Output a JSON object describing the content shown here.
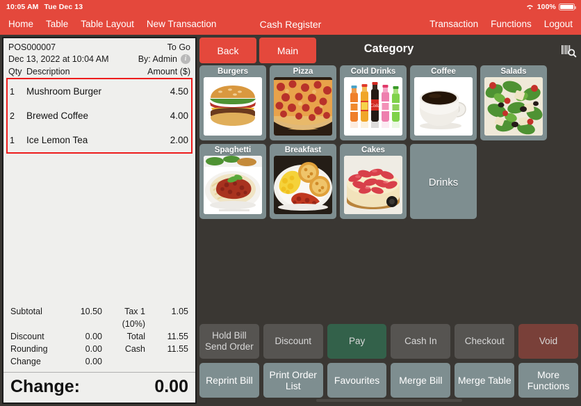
{
  "statusbar": {
    "time": "10:05 AM",
    "date": "Tue Dec 13",
    "wifi_icon": "wifi-icon",
    "battery_percent": "100%",
    "battery_icon": "battery-full-icon"
  },
  "navbar": {
    "title": "Cash Register",
    "left_items": [
      {
        "label": "Home",
        "name": "nav-home"
      },
      {
        "label": "Table",
        "name": "nav-table"
      },
      {
        "label": "Table Layout",
        "name": "nav-table-layout"
      },
      {
        "label": "New Transaction",
        "name": "nav-new-transaction"
      }
    ],
    "right_items": [
      {
        "label": "Transaction",
        "name": "nav-transaction"
      },
      {
        "label": "Functions",
        "name": "nav-functions"
      },
      {
        "label": "Logout",
        "name": "nav-logout"
      }
    ]
  },
  "receipt": {
    "order_id": "POS000007",
    "order_type": "To Go",
    "datetime": "Dec 13, 2022 at 10:04 AM",
    "cashier": "By: Admin",
    "info_icon": "info-icon",
    "columns": {
      "qty": "Qty",
      "description": "Description",
      "amount": "Amount ($)"
    },
    "items": [
      {
        "qty": "1",
        "description": "Mushroom Burger",
        "amount": "4.50"
      },
      {
        "qty": "2",
        "description": "Brewed Coffee",
        "amount": "4.00"
      },
      {
        "qty": "1",
        "description": "Ice Lemon Tea",
        "amount": "2.00"
      }
    ],
    "totals": [
      {
        "label_a": "Subtotal",
        "value_a": "10.50",
        "label_b": "Tax 1 (10%)",
        "value_b": "1.05"
      },
      {
        "label_a": "Discount",
        "value_a": "0.00",
        "label_b": "Total",
        "value_b": "11.55"
      },
      {
        "label_a": "Rounding",
        "value_a": "0.00",
        "label_b": "Cash",
        "value_b": "11.55"
      },
      {
        "label_a": "Change",
        "value_a": "0.00",
        "label_b": "",
        "value_b": ""
      }
    ],
    "change_label": "Change:",
    "change_value": "0.00",
    "highlight_color": "#ed1c1c"
  },
  "category_panel": {
    "back_label": "Back",
    "main_label": "Main",
    "title": "Category",
    "scan_icon": "barcode-search-icon",
    "tiles": [
      {
        "label": "Burgers",
        "image": "burger-image",
        "kind": "image"
      },
      {
        "label": "Pizza",
        "image": "pizza-image",
        "kind": "image"
      },
      {
        "label": "Cold Drinks",
        "image": "cold-drinks-image",
        "kind": "image"
      },
      {
        "label": "Coffee",
        "image": "coffee-cup-image",
        "kind": "image"
      },
      {
        "label": "Salads",
        "image": "salad-image",
        "kind": "image"
      },
      {
        "label": "Spaghetti",
        "image": "spaghetti-image",
        "kind": "image"
      },
      {
        "label": "Breakfast",
        "image": "breakfast-image",
        "kind": "image"
      },
      {
        "label": "Cakes",
        "image": "cake-image",
        "kind": "image"
      },
      {
        "label": "Drinks",
        "image": "",
        "kind": "plain"
      }
    ]
  },
  "actions": {
    "row1": [
      {
        "label": "Hold Bill\nSend Order",
        "style": "grey",
        "name": "hold-bill-send-order-button"
      },
      {
        "label": "Discount",
        "style": "grey",
        "name": "discount-button"
      },
      {
        "label": "Pay",
        "style": "green",
        "name": "pay-button"
      },
      {
        "label": "Cash In",
        "style": "grey",
        "name": "cash-in-button"
      },
      {
        "label": "Checkout",
        "style": "grey",
        "name": "checkout-button"
      },
      {
        "label": "Void",
        "style": "vred",
        "name": "void-button"
      }
    ],
    "row2": [
      {
        "label": "Reprint Bill",
        "style": "sage",
        "name": "reprint-bill-button"
      },
      {
        "label": "Print Order\nList",
        "style": "sage",
        "name": "print-order-list-button"
      },
      {
        "label": "Favourites",
        "style": "sage",
        "name": "favourites-button"
      },
      {
        "label": "Merge Bill",
        "style": "sage",
        "name": "merge-bill-button"
      },
      {
        "label": "Merge Table",
        "style": "sage",
        "name": "merge-table-button"
      },
      {
        "label": "More\nFunctions",
        "style": "sage",
        "name": "more-functions-button"
      }
    ]
  },
  "colors": {
    "accent_red": "#e4483c",
    "panel_dark": "#3a3733",
    "tile_sage": "#7e8e90",
    "pay_green": "#33614a",
    "void_red": "#794039",
    "highlight": "#ed1c1c"
  }
}
